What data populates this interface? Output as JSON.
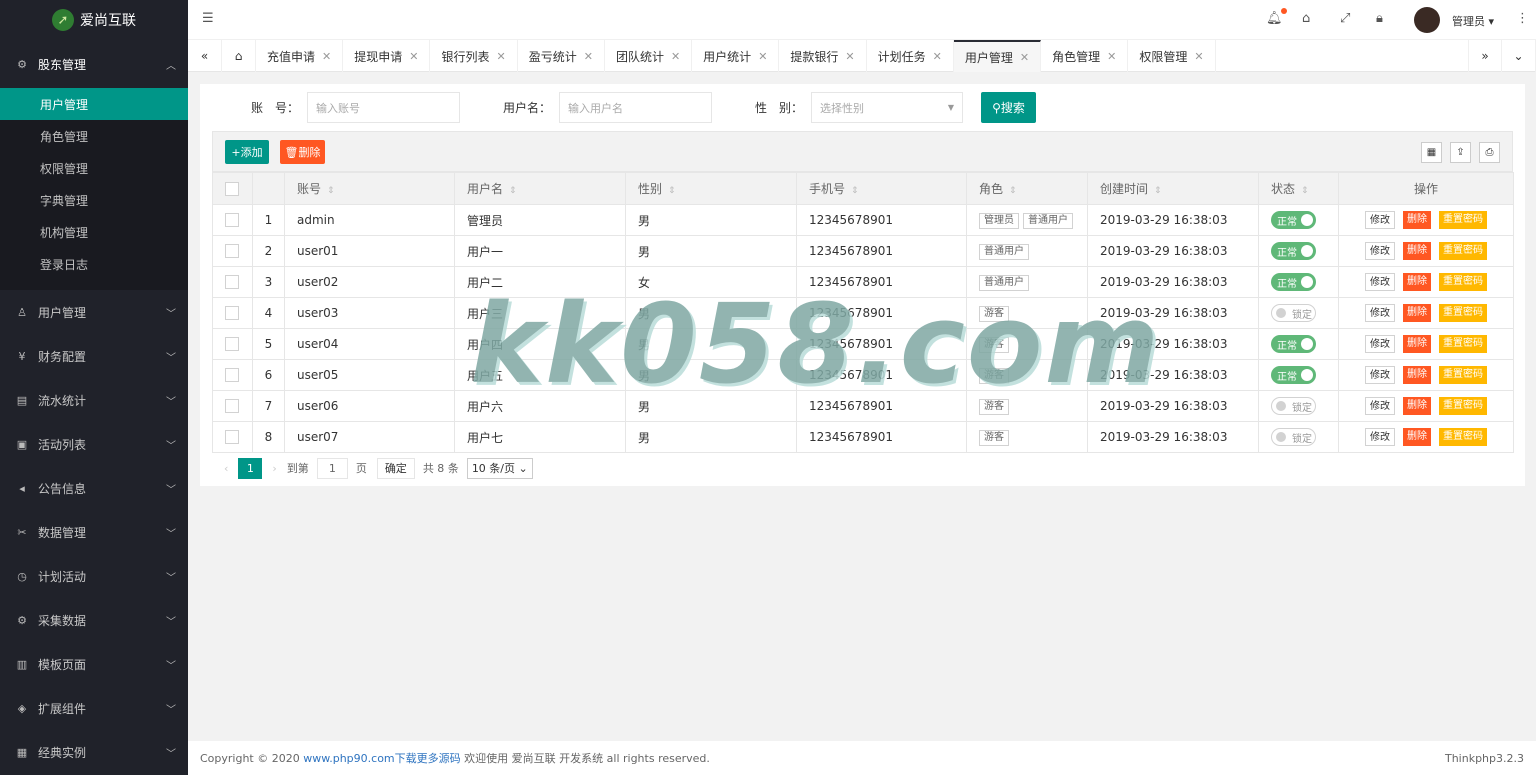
{
  "brand": {
    "name": "爱尚互联"
  },
  "sidebar": {
    "open_group": {
      "label": "股东管理",
      "icon": "gear-icon"
    },
    "sub_items": [
      "用户管理",
      "角色管理",
      "权限管理",
      "字典管理",
      "机构管理",
      "登录日志"
    ],
    "groups": [
      {
        "label": "用户管理",
        "icon": "user-icon"
      },
      {
        "label": "财务配置",
        "icon": "yen-icon"
      },
      {
        "label": "流水统计",
        "icon": "receipt-icon"
      },
      {
        "label": "活动列表",
        "icon": "gift-icon"
      },
      {
        "label": "公告信息",
        "icon": "speaker-icon"
      },
      {
        "label": "数据管理",
        "icon": "tools-icon"
      },
      {
        "label": "计划活动",
        "icon": "clock-icon"
      },
      {
        "label": "采集数据",
        "icon": "gear-icon"
      },
      {
        "label": "模板页面",
        "icon": "template-icon"
      },
      {
        "label": "扩展组件",
        "icon": "cube-icon"
      },
      {
        "label": "经典实例",
        "icon": "grid-icon"
      }
    ]
  },
  "topbar": {
    "user_label": "管理员"
  },
  "tabs": [
    "充值申请",
    "提现申请",
    "银行列表",
    "盈亏统计",
    "团队统计",
    "用户统计",
    "提款银行",
    "计划任务",
    "用户管理",
    "角色管理",
    "权限管理"
  ],
  "filters": {
    "account_label": "账　号：",
    "account_placeholder": "输入账号",
    "username_label": "用户名：",
    "username_placeholder": "输入用户名",
    "gender_label": "性　别：",
    "gender_placeholder": "选择性别",
    "search_label": "搜索"
  },
  "toolbar": {
    "add_label": "添加",
    "delete_label": "删除"
  },
  "table": {
    "headers": [
      "账号",
      "用户名",
      "性别",
      "手机号",
      "角色",
      "创建时间",
      "状态",
      "操作"
    ],
    "rows": [
      {
        "no": "1",
        "account": "admin",
        "name": "管理员",
        "gender": "男",
        "phone": "12345678901",
        "roles": [
          "管理员",
          "普通用户"
        ],
        "created": "2019-03-29 16:38:03",
        "status": "正常"
      },
      {
        "no": "2",
        "account": "user01",
        "name": "用户一",
        "gender": "男",
        "phone": "12345678901",
        "roles": [
          "普通用户"
        ],
        "created": "2019-03-29 16:38:03",
        "status": "正常"
      },
      {
        "no": "3",
        "account": "user02",
        "name": "用户二",
        "gender": "女",
        "phone": "12345678901",
        "roles": [
          "普通用户"
        ],
        "created": "2019-03-29 16:38:03",
        "status": "正常"
      },
      {
        "no": "4",
        "account": "user03",
        "name": "用户三",
        "gender": "男",
        "phone": "12345678901",
        "roles": [
          "游客"
        ],
        "created": "2019-03-29 16:38:03",
        "status": "锁定"
      },
      {
        "no": "5",
        "account": "user04",
        "name": "用户四",
        "gender": "男",
        "phone": "12345678901",
        "roles": [
          "游客"
        ],
        "created": "2019-03-29 16:38:03",
        "status": "正常"
      },
      {
        "no": "6",
        "account": "user05",
        "name": "用户五",
        "gender": "男",
        "phone": "12345678901",
        "roles": [
          "游客"
        ],
        "created": "2019-03-29 16:38:03",
        "status": "正常"
      },
      {
        "no": "7",
        "account": "user06",
        "name": "用户六",
        "gender": "男",
        "phone": "12345678901",
        "roles": [
          "游客"
        ],
        "created": "2019-03-29 16:38:03",
        "status": "锁定"
      },
      {
        "no": "8",
        "account": "user07",
        "name": "用户七",
        "gender": "男",
        "phone": "12345678901",
        "roles": [
          "游客"
        ],
        "created": "2019-03-29 16:38:03",
        "status": "锁定"
      }
    ],
    "actions": {
      "edit": "修改",
      "delete": "删除",
      "reset": "重置密码"
    }
  },
  "pager": {
    "current": "1",
    "goto_label": "到第",
    "page_value": "1",
    "page_suffix": "页",
    "confirm": "确定",
    "total": "共 8 条",
    "per_page": "10 条/页"
  },
  "footer": {
    "copyright": "Copyright © 2020",
    "link": "www.php90.com下载更多源码",
    "suffix": "欢迎使用 爱尚互联 开发系统 all rights reserved.",
    "version": "Thinkphp3.2.3"
  },
  "watermark": "kk058.com"
}
